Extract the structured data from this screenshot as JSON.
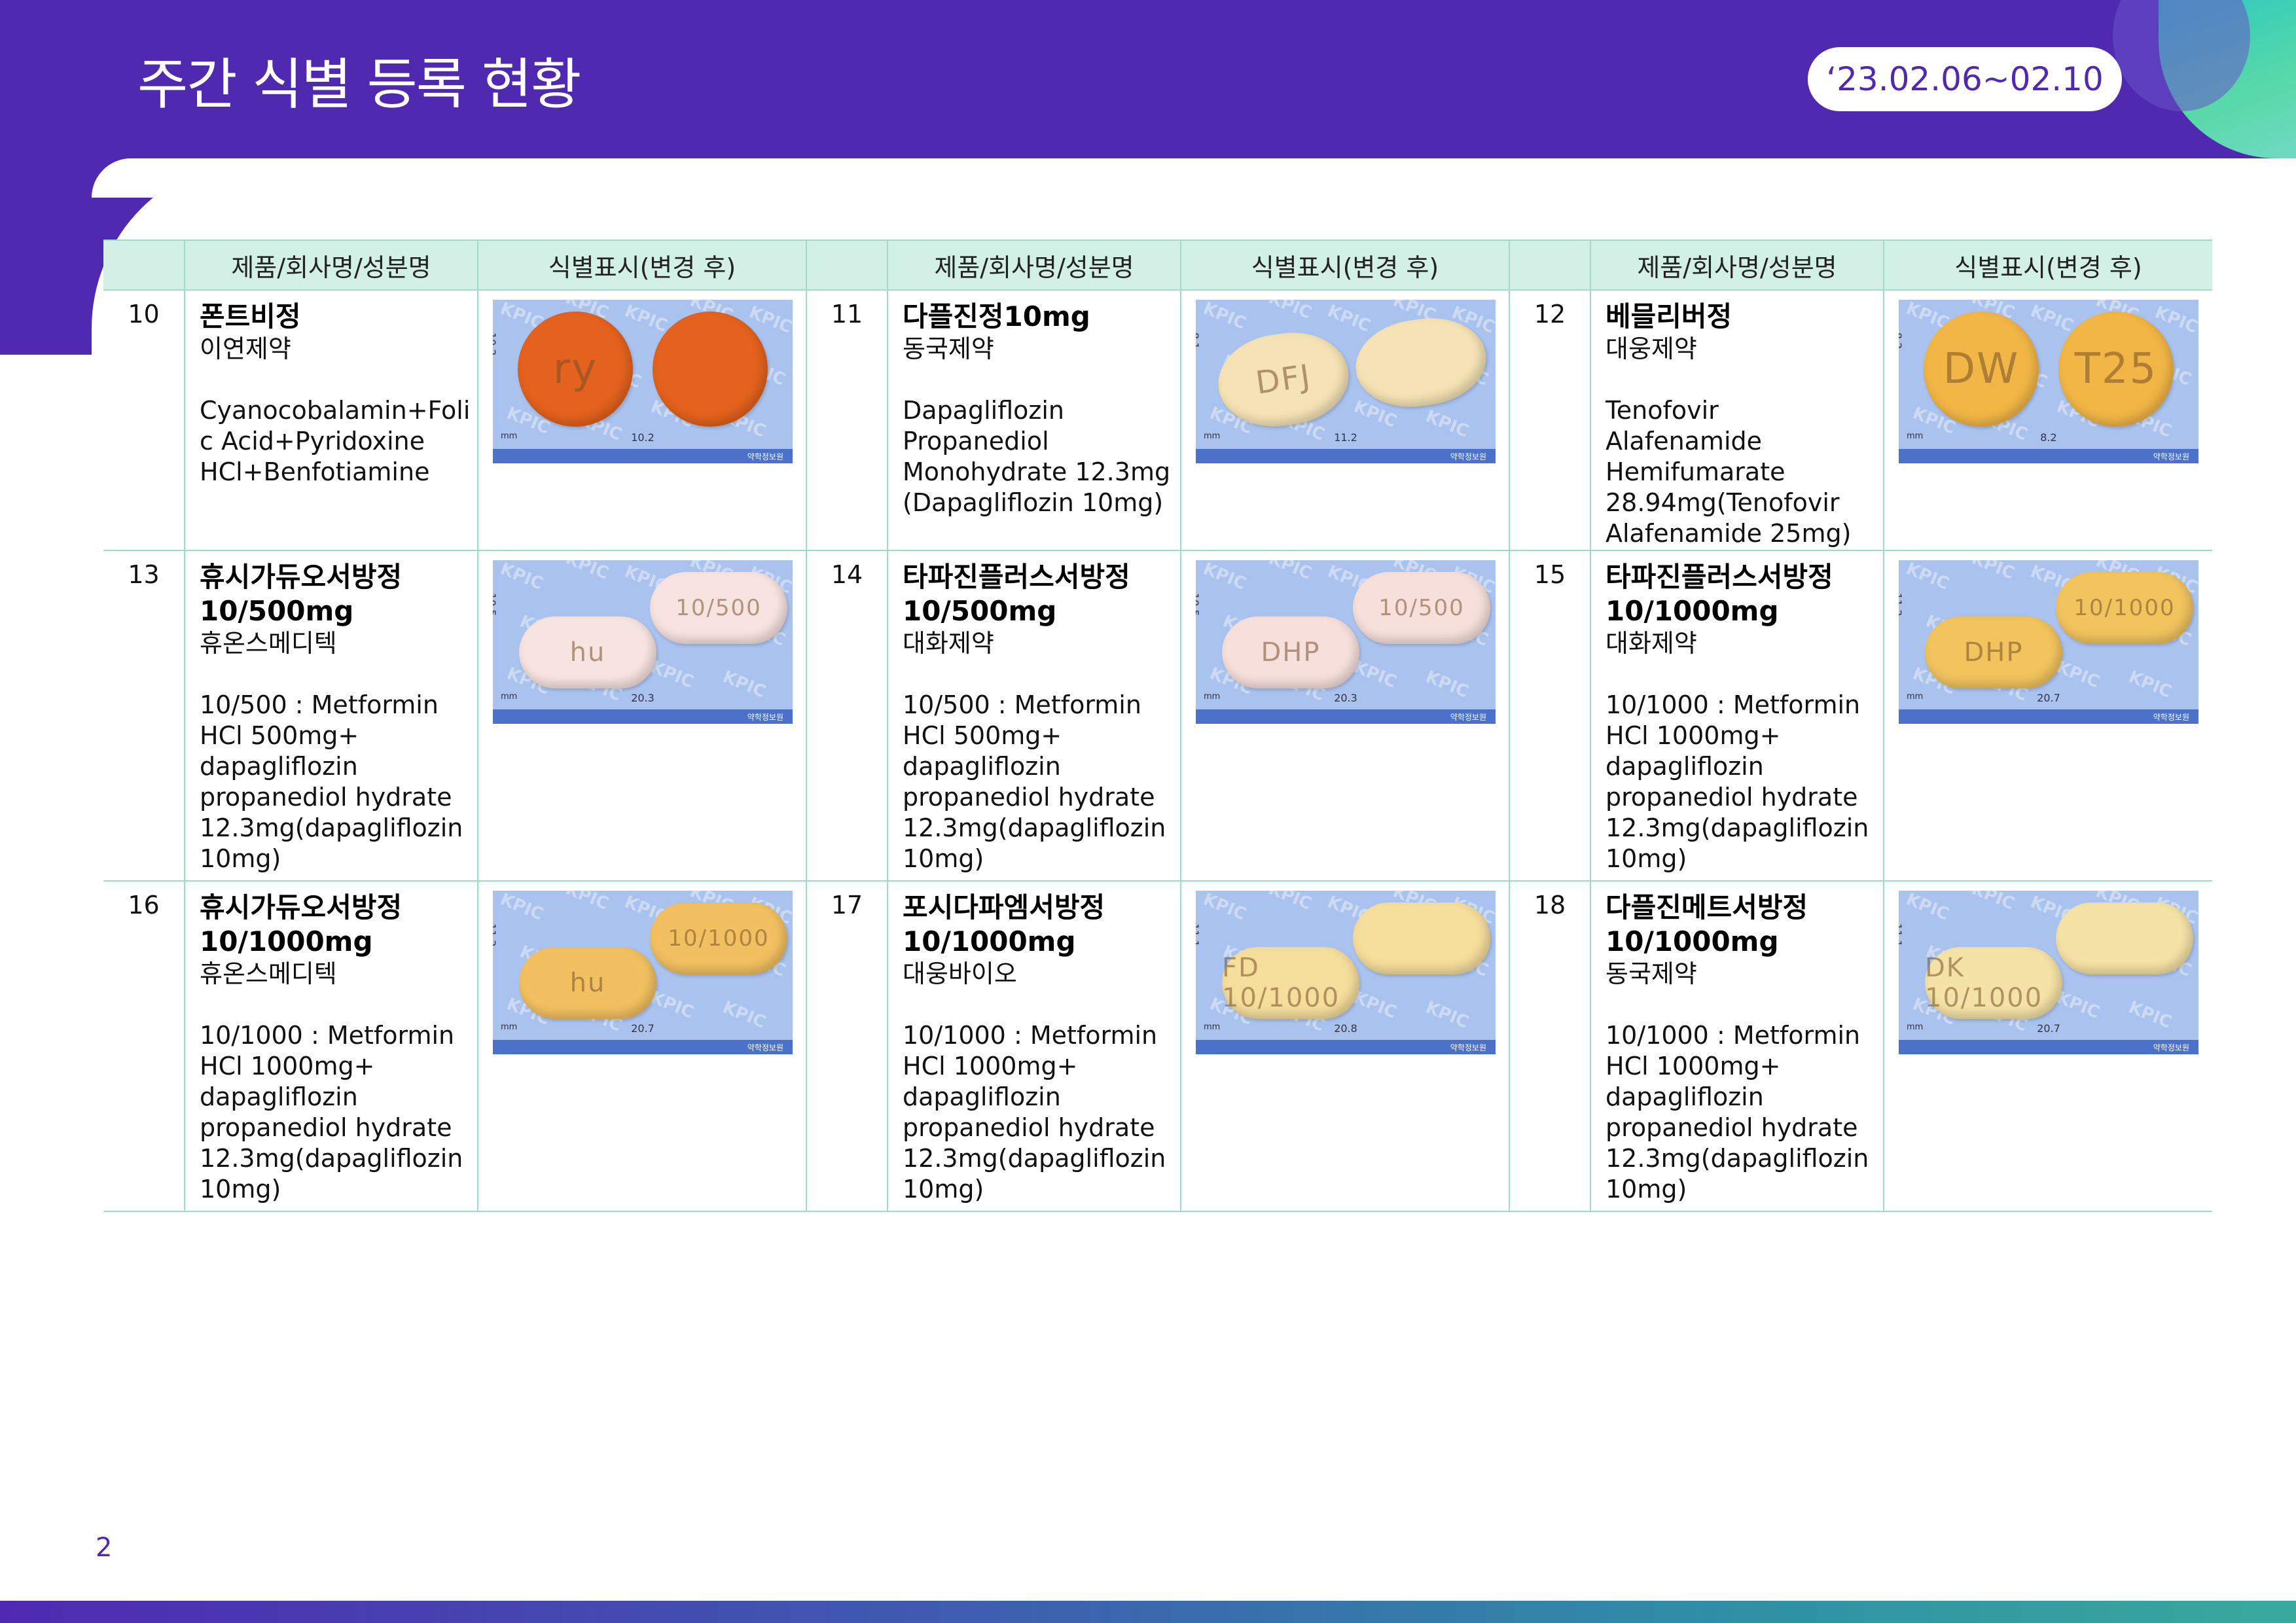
{
  "header": {
    "title": "주간 식별 등록 현황",
    "date_range": "‘23.02.06~02.10"
  },
  "table": {
    "columns": [
      "",
      "제품/회사명/성분명",
      "식별표시(변경 후)",
      "",
      "제품/회사명/성분명",
      "식별표시(변경 후)",
      "",
      "제품/회사명/성분명",
      "식별표시(변경 후)"
    ],
    "watermark": "KPIC",
    "image_footer": "약학정보원",
    "image_unit": "mm",
    "rows": [
      [
        {
          "num": "10",
          "name": "폰트비정",
          "company": "이연제약",
          "ingredient": "Cyanocobalamin+Folic Acid+Pyridoxine HCl+Benfotiamine",
          "height": "10.2",
          "width": "10.2",
          "pill_color": "#e4621d",
          "pill_shape": "round",
          "mark1": "ry",
          "mark2": ""
        },
        {
          "num": "11",
          "name": "다플진정10mg",
          "company": "동국제약",
          "ingredient": "Dapagliflozin Propanediol Monohydrate 12.3mg (Dapagliflozin 10mg)",
          "height": "8.1",
          "width": "11.2",
          "pill_color": "#f5e3b5",
          "pill_shape": "diamond",
          "mark1": "DFJ",
          "mark2": ""
        },
        {
          "num": "12",
          "name": "베믈리버정",
          "company": "대웅제약",
          "ingredient": "Tenofovir Alafenamide Hemifumarate 28.94mg(Tenofovir Alafenamide 25mg)",
          "height": "8.2",
          "width": "8.2",
          "pill_color": "#f2b646",
          "pill_shape": "round",
          "mark1": "DW",
          "mark2": "T25"
        }
      ],
      [
        {
          "num": "13",
          "name": "휴시가듀오서방정 10/500mg",
          "company": "휴온스메디텍",
          "ingredient": "10/500 : Metformin HCl 500mg+ dapagliflozin propanediol hydrate 12.3mg(dapagliflozin 10mg)",
          "height": "10.5",
          "width": "20.3",
          "pill_color": "#f7e3e0",
          "pill_shape": "oblong",
          "mark1": "hu",
          "mark2": "10/500"
        },
        {
          "num": "14",
          "name": "타파진플러스서방정 10/500mg",
          "company": "대화제약",
          "ingredient": "10/500 : Metformin HCl 500mg+ dapagliflozin propanediol hydrate 12.3mg(dapagliflozin 10mg)",
          "height": "10.5",
          "width": "20.3",
          "pill_color": "#f7e0dc",
          "pill_shape": "oblong",
          "mark1": "DHP",
          "mark2": "10/500"
        },
        {
          "num": "15",
          "name": "타파진플러스서방정 10/1000mg",
          "company": "대화제약",
          "ingredient": "10/1000 : Metformin HCl 1000mg+ dapagliflozin propanediol hydrate 12.3mg(dapagliflozin 10mg)",
          "height": "11.2",
          "width": "20.7",
          "pill_color": "#f2c45e",
          "pill_shape": "oblong",
          "mark1": "DHP",
          "mark2": "10/1000"
        }
      ],
      [
        {
          "num": "16",
          "name": "휴시가듀오서방정 10/1000mg",
          "company": "휴온스메디텍",
          "ingredient": "10/1000 : Metformin HCl 1000mg+ dapagliflozin propanediol hydrate 12.3mg(dapagliflozin 10mg)",
          "height": "11.2",
          "width": "20.7",
          "pill_color": "#f2c060",
          "pill_shape": "oblong",
          "mark1": "hu",
          "mark2": "10/1000"
        },
        {
          "num": "17",
          "name": "포시다파엠서방정 10/1000mg",
          "company": "대웅바이오",
          "ingredient": "10/1000 : Metformin HCl 1000mg+ dapagliflozin propanediol hydrate 12.3mg(dapagliflozin 10mg)",
          "height": "11.1",
          "width": "20.8",
          "pill_color": "#f5dd9c",
          "pill_shape": "oblong",
          "mark1": "FD 10/1000",
          "mark2": ""
        },
        {
          "num": "18",
          "name": "다플진메트서방정 10/1000mg",
          "company": "동국제약",
          "ingredient": "10/1000 : Metformin HCl 1000mg+ dapagliflozin propanediol hydrate 12.3mg(dapagliflozin 10mg)",
          "height": "11.1",
          "width": "20.7",
          "pill_color": "#f5e2a6",
          "pill_shape": "oblong",
          "mark1": "DK 10/1000",
          "mark2": ""
        }
      ]
    ]
  },
  "footer": {
    "page_number": "2"
  },
  "colors": {
    "brand": "#4f2ab1",
    "header_row": "#d3f0e6",
    "border": "#9fdcc6",
    "image_bg": "#a9c2ee"
  }
}
